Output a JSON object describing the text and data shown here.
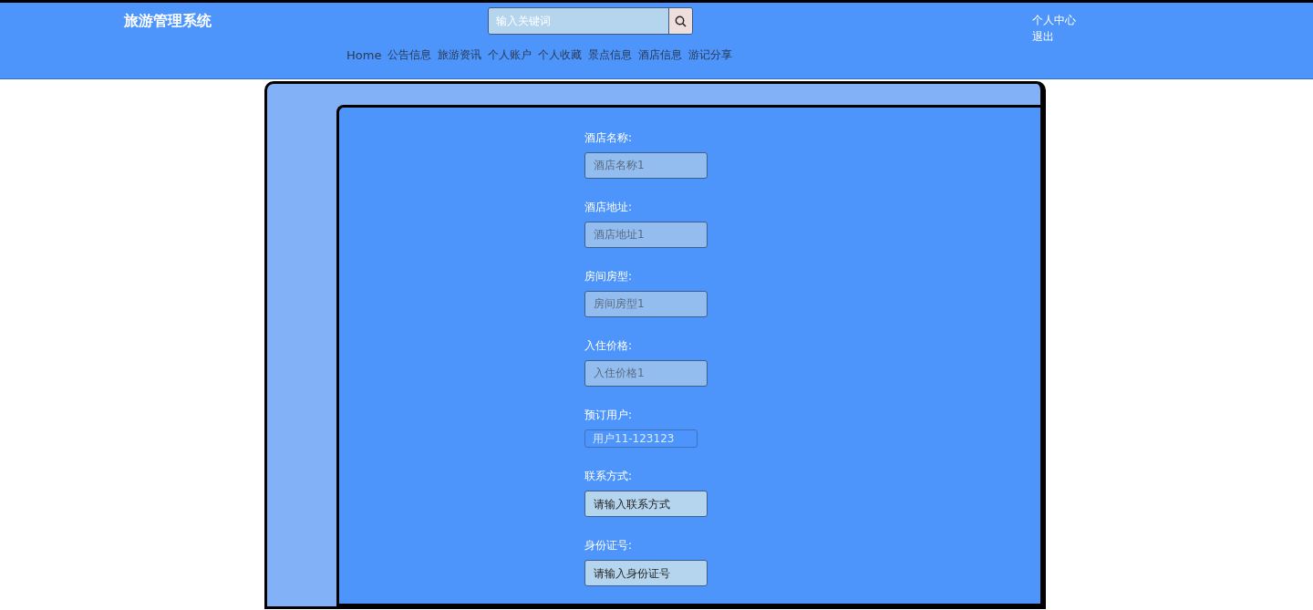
{
  "header": {
    "title": "旅游管理系统",
    "search": {
      "placeholder": "输入关键词"
    },
    "nav": [
      {
        "label": "Home"
      },
      {
        "label": "公告信息"
      },
      {
        "label": "旅游资讯"
      },
      {
        "label": "个人账户"
      },
      {
        "label": "个人收藏"
      },
      {
        "label": "景点信息"
      },
      {
        "label": "酒店信息"
      },
      {
        "label": "游记分享"
      }
    ],
    "user_links": [
      {
        "label": "个人中心"
      },
      {
        "label": "退出"
      }
    ]
  },
  "form": {
    "fields": [
      {
        "kind": "input",
        "label": "酒店名称:",
        "value": "酒店名称1",
        "disabled": true
      },
      {
        "kind": "input",
        "label": "酒店地址:",
        "value": "酒店地址1",
        "disabled": true
      },
      {
        "kind": "input",
        "label": "房间房型:",
        "value": "房间房型1",
        "disabled": true
      },
      {
        "kind": "input",
        "label": "入住价格:",
        "value": "入住价格1",
        "disabled": true
      },
      {
        "kind": "select",
        "label": "预订用户:",
        "value": "用户11-123123",
        "disabled": true
      },
      {
        "kind": "input",
        "label": "联系方式:",
        "placeholder": "请输入联系方式",
        "disabled": false
      },
      {
        "kind": "input",
        "label": "身份证号:",
        "placeholder": "请输入身份证号",
        "disabled": false
      }
    ]
  }
}
